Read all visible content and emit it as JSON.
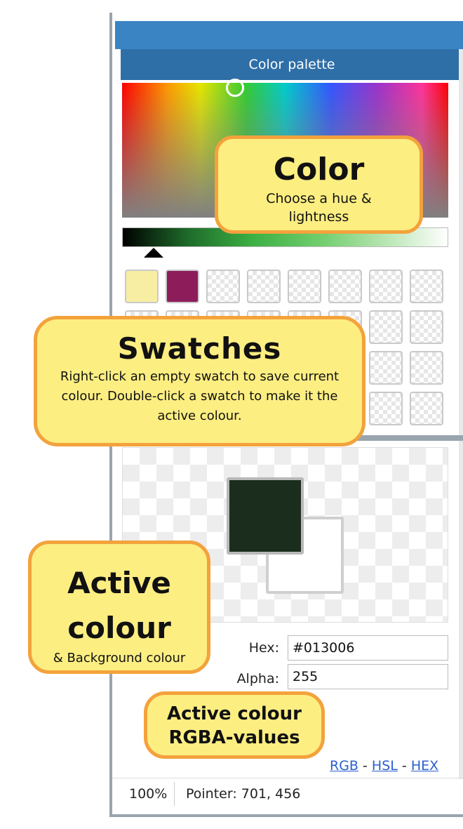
{
  "panel": {
    "title": "Color palette",
    "foreground_color": "#1b2e1d",
    "selected_swatch_colors": [
      "#f7eea3",
      "#8d1c5a"
    ]
  },
  "fields": {
    "hex_label": "Hex:",
    "hex_value": "#013006",
    "alpha_label": "Alpha:",
    "alpha_value": "255"
  },
  "links": {
    "rgb": "RGB",
    "hsl": "HSL",
    "hex": "HEX",
    "separator": "-"
  },
  "status": {
    "zoom": "100%",
    "pointer": "Pointer: 701, 456"
  },
  "callouts": {
    "color": {
      "title": "Color",
      "text": "Choose a hue & lightness"
    },
    "swatches": {
      "title": "Swatches",
      "text": "Right-click an empty swatch to save current colour. Double-click a swatch to make it the active colour."
    },
    "active": {
      "title": "Active colour",
      "text": "& Background colour"
    },
    "rgba": {
      "title": "Active colour RGBA-values"
    }
  },
  "colors": {
    "accent": "#3b84c4",
    "titlebar": "#2f6fa8",
    "callout_fill": "#fdee82",
    "callout_border": "#f3a23c",
    "link": "#2c5fcf"
  }
}
